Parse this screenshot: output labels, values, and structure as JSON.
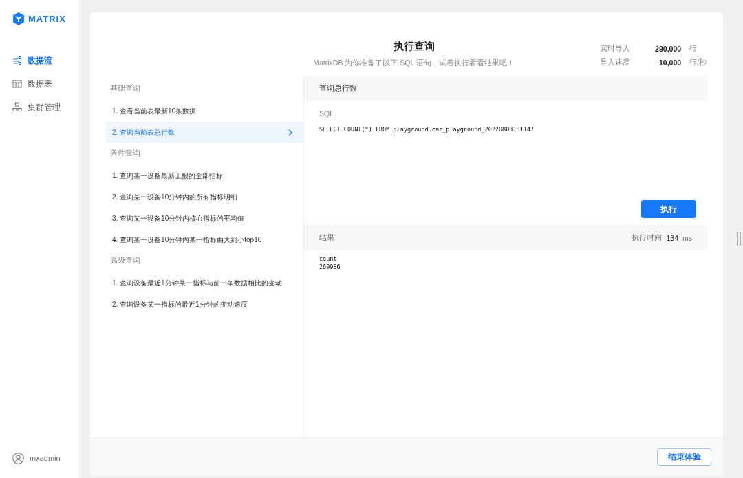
{
  "brand": {
    "name": "MATRIX"
  },
  "nav": [
    {
      "label": "数据流",
      "kind": "flow",
      "selected": true
    },
    {
      "label": "数据表",
      "kind": "table",
      "selected": false
    },
    {
      "label": "集群管理",
      "kind": "cluster",
      "selected": false
    }
  ],
  "user": {
    "name": "mxadmin"
  },
  "header": {
    "title": "执行查询",
    "subtitle": "MatrixDB 为你准备了以下 SQL 语句，试着执行看看结果吧！",
    "stats": [
      {
        "label": "实时导入",
        "value": "290,000",
        "unit": "行"
      },
      {
        "label": "导入速度",
        "value": "10,000",
        "unit": "行/秒"
      }
    ]
  },
  "query_groups": [
    {
      "title": "基础查询",
      "items": [
        {
          "label": "1. 查看当前表最新10条数据",
          "selected": false
        },
        {
          "label": "2. 查询当前表总行数",
          "selected": true
        }
      ]
    },
    {
      "title": "条件查询",
      "items": [
        {
          "label": "1. 查询某一设备最新上报的全部指标",
          "selected": false
        },
        {
          "label": "2. 查询某一设备10分钟内的所有指标明细",
          "selected": false
        },
        {
          "label": "3. 查询某一设备10分钟内核心指标的平均值",
          "selected": false
        },
        {
          "label": "4. 查询某一设备10分钟内某一指标由大到小top10",
          "selected": false
        }
      ]
    },
    {
      "title": "高级查询",
      "items": [
        {
          "label": "1. 查询设备最近1分钟某一指标与前一条数据相比的变动",
          "selected": false
        },
        {
          "label": "2. 查询设备某一指标的最近1分钟的变动速度",
          "selected": false
        }
      ]
    }
  ],
  "detail": {
    "title": "查询总行数",
    "sql_label": "SQL",
    "sql": "SELECT COUNT(*) FROM playground.car_playground_20220803181147",
    "run_button": "执行",
    "result_label": "结果",
    "time_label": "执行时间",
    "time_value": "134",
    "time_unit": "ms",
    "result_lines": [
      "count",
      "269986"
    ]
  },
  "footer": {
    "end_button": "结束体验"
  }
}
